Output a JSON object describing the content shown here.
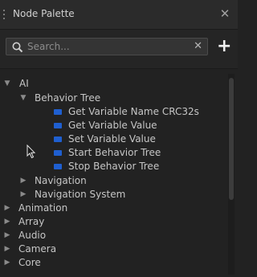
{
  "window": {
    "title": "Node Palette",
    "close_glyph": "✕"
  },
  "search": {
    "placeholder": "Search...",
    "value": "",
    "clear_glyph": "✕",
    "icon": "search-icon"
  },
  "toolbar": {
    "add_glyph": "+"
  },
  "tree": {
    "ai": {
      "label": "AI",
      "expanded": true,
      "behavior_tree": {
        "label": "Behavior Tree",
        "expanded": true,
        "items": [
          "Get Variable Name CRC32s",
          "Get Variable Value",
          "Set Variable Value",
          "Start Behavior Tree",
          "Stop Behavior Tree"
        ]
      },
      "navigation": "Navigation",
      "navigation_system": "Navigation System"
    },
    "roots": [
      "Animation",
      "Array",
      "Audio",
      "Camera",
      "Core"
    ]
  },
  "colors": {
    "leaf_icon": "#1f5fd0",
    "background": "#222222",
    "titlebar": "#2b2b2b"
  }
}
